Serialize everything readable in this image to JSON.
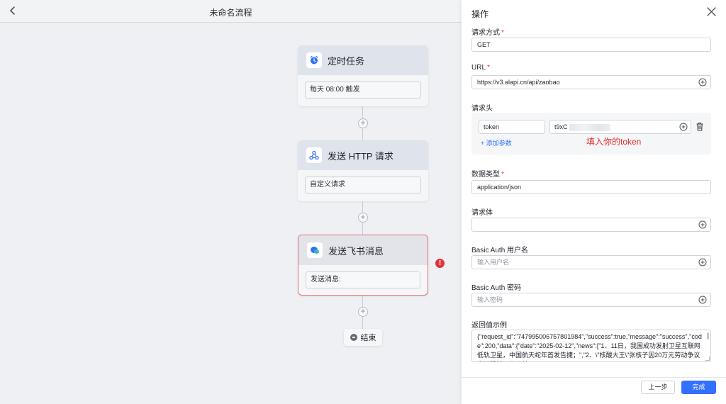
{
  "canvas": {
    "title": "未命名流程",
    "nodes": [
      {
        "title": "定时任务",
        "field": "每天 08:00 触发",
        "icon": "alarm-clock-icon"
      },
      {
        "title": "发送 HTTP 请求",
        "field": "自定义请求",
        "icon": "webhook-icon"
      },
      {
        "title": "发送飞书消息",
        "field": "发送消息:",
        "icon": "feishu-chat-icon",
        "has_error": true
      }
    ],
    "error_badge": "!",
    "plus_label": "+",
    "end_label": "结束"
  },
  "drawer": {
    "title": "操作",
    "method": {
      "label": "请求方式",
      "value": "GET"
    },
    "url": {
      "label": "URL",
      "value": "https://v3.alapi.cn/api/zaobao"
    },
    "headers": {
      "label": "请求头",
      "key": "token",
      "value_visible": "t9xC",
      "add_param": "+ 添加参数",
      "annotation": "填入你的token"
    },
    "content_type": {
      "label": "数据类型",
      "value": "application/json"
    },
    "body": {
      "label": "请求体",
      "value": ""
    },
    "basic_user": {
      "label": "Basic Auth 用户名",
      "placeholder": "输入用户名"
    },
    "basic_pass": {
      "label": "Basic Auth 密码",
      "placeholder": "输入密码"
    },
    "example": {
      "label": "返回值示例",
      "value": "{\"request_id\":\"747995006757801984\",\"success\":true,\"message\":\"success\",\"code\":200,\"data\":{\"date\":\"2025-02-12\",\"news\":[\"1、11日，我国成功发射卫星互联网低轨卫星，中国航天蛇年首发告捷；\",\"2、\\\"核酸大王\\\"张核子因20万元劳动争议案被限消，核子基"
    },
    "required_mark": "*",
    "prev_button": "上一步",
    "done_button": "完成"
  },
  "colors": {
    "accent": "#3370ff",
    "danger": "#e0343e",
    "annotation": "#e02d2d"
  }
}
